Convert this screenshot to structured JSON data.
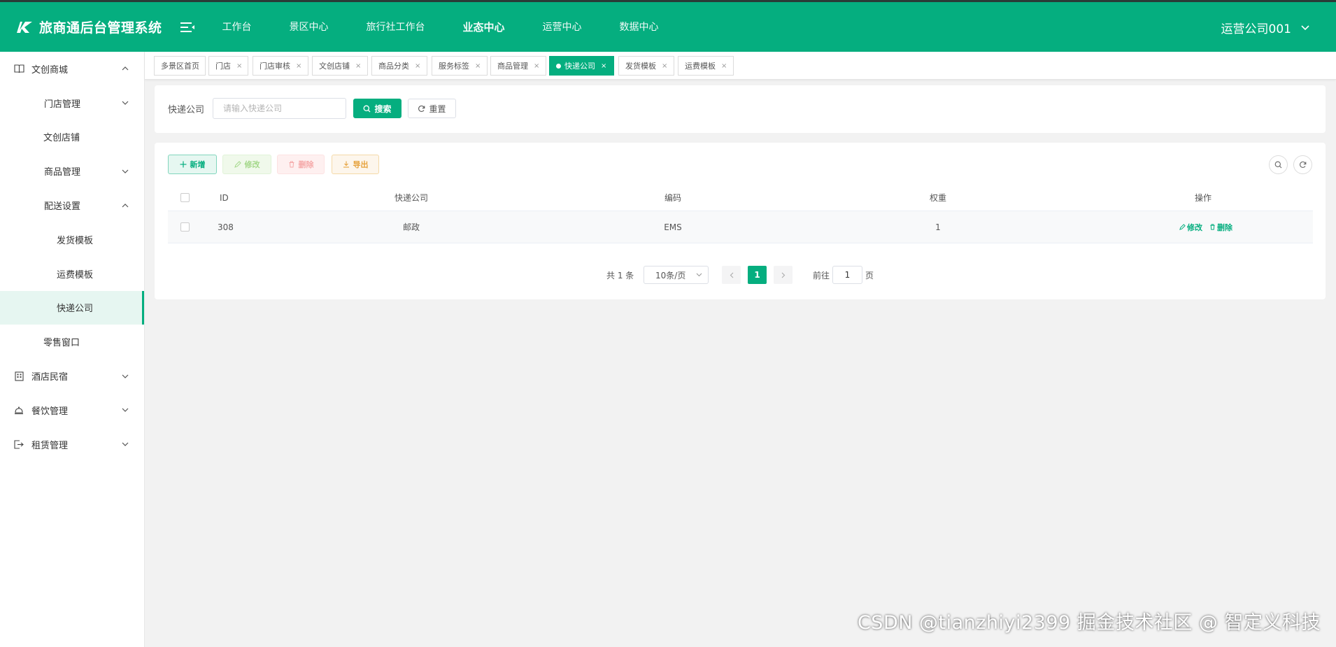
{
  "header": {
    "title": "旅商通后台管理系统",
    "nav": [
      "工作台",
      "景区中心",
      "旅行社工作台",
      "业态中心",
      "运营中心",
      "数据中心"
    ],
    "active_nav": "业态中心",
    "user": "运营公司001"
  },
  "sidebar": {
    "items": [
      {
        "label": "文创商城",
        "level": 1,
        "icon": "book-icon",
        "arrow": "up"
      },
      {
        "label": "门店管理",
        "level": 2,
        "arrow": "down"
      },
      {
        "label": "文创店铺",
        "level": 2
      },
      {
        "label": "商品管理",
        "level": 2,
        "arrow": "down"
      },
      {
        "label": "配送设置",
        "level": 2,
        "arrow": "up"
      },
      {
        "label": "发货模板",
        "level": 3
      },
      {
        "label": "运费模板",
        "level": 3
      },
      {
        "label": "快递公司",
        "level": 3,
        "active": true
      },
      {
        "label": "零售窗口",
        "level": 2
      },
      {
        "label": "酒店民宿",
        "level": 1,
        "icon": "building-icon",
        "arrow": "down"
      },
      {
        "label": "餐饮管理",
        "level": 1,
        "icon": "dish-icon",
        "arrow": "down"
      },
      {
        "label": "租赁管理",
        "level": 1,
        "icon": "exit-icon",
        "arrow": "down"
      }
    ]
  },
  "tabs": [
    {
      "label": "多景区首页",
      "closable": false
    },
    {
      "label": "门店",
      "closable": true
    },
    {
      "label": "门店审核",
      "closable": true
    },
    {
      "label": "文创店铺",
      "closable": true
    },
    {
      "label": "商品分类",
      "closable": true
    },
    {
      "label": "服务标签",
      "closable": true
    },
    {
      "label": "商品管理",
      "closable": true
    },
    {
      "label": "快递公司",
      "closable": true,
      "active": true
    },
    {
      "label": "发货模板",
      "closable": true
    },
    {
      "label": "运费模板",
      "closable": true
    }
  ],
  "search": {
    "label": "快递公司",
    "placeholder": "请输入快递公司",
    "value": "",
    "search_btn": "搜索",
    "reset_btn": "重置"
  },
  "toolbar": {
    "add": "新增",
    "edit": "修改",
    "delete": "删除",
    "export": "导出"
  },
  "table": {
    "columns": [
      "ID",
      "快递公司",
      "编码",
      "权重",
      "操作"
    ],
    "rows": [
      {
        "id": "308",
        "company": "邮政",
        "code": "EMS",
        "weight": "1",
        "edit": "修改",
        "delete": "删除"
      }
    ]
  },
  "pagination": {
    "total": "共 1 条",
    "page_size": "10条/页",
    "current": "1",
    "goto_label": "前往",
    "goto_value": "1",
    "goto_unit": "页"
  },
  "watermark": "CSDN @tianzhiyi2399 掘金技术社区 @ 智定义科技",
  "colors": {
    "primary": "#05ae7f",
    "header_bg": "#05ae7f",
    "active_menu_bg": "#e6f6f1"
  }
}
